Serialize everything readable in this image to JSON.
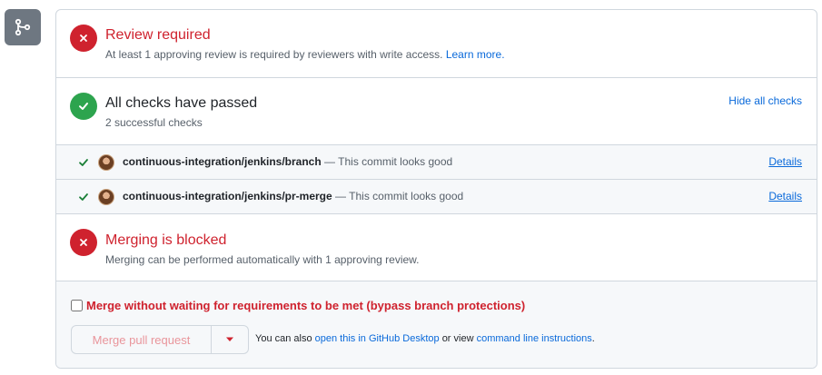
{
  "review": {
    "title": "Review required",
    "subtitle": "At least 1 approving review is required by reviewers with write access.",
    "learn_more": "Learn more."
  },
  "checks": {
    "title": "All checks have passed",
    "subtitle": "2 successful checks",
    "hide_label": "Hide all checks",
    "items": [
      {
        "context": "continuous-integration/jenkins/branch",
        "description": "— This commit looks good",
        "details_label": "Details"
      },
      {
        "context": "continuous-integration/jenkins/pr-merge",
        "description": "— This commit looks good",
        "details_label": "Details"
      }
    ]
  },
  "blocked": {
    "title": "Merging is blocked",
    "subtitle": "Merging can be performed automatically with 1 approving review."
  },
  "footer": {
    "bypass_label": "Merge without waiting for requirements to be met (bypass branch protections)",
    "merge_button": "Merge pull request",
    "alt_prefix": "You can also",
    "desktop_link": "open this in GitHub Desktop",
    "alt_middle": "or view",
    "cli_link": "command line instructions",
    "alt_suffix": "."
  },
  "colors": {
    "danger": "#cf222e",
    "success": "#2da44e",
    "link": "#0969da",
    "neutral_icon_bg": "#6e7781"
  },
  "icons": {
    "merge_state": "git-merge-icon",
    "fail": "x-circle-icon",
    "pass": "check-circle-icon",
    "row_check": "check-icon",
    "dropdown": "triangle-down-icon"
  }
}
